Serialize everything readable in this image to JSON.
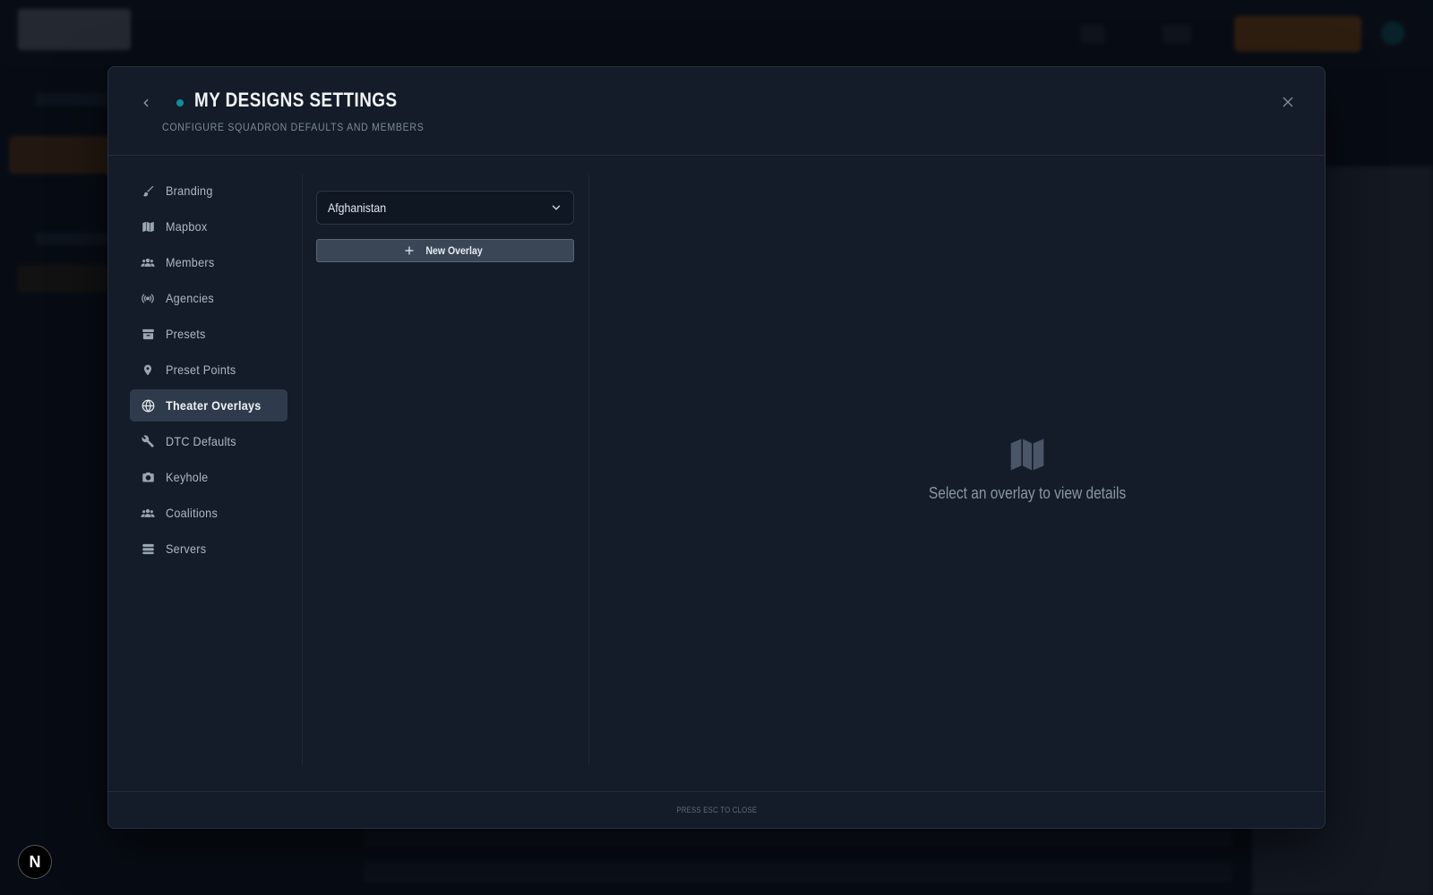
{
  "modal": {
    "title": "MY DESIGNS SETTINGS",
    "subtitle": "CONFIGURE SQUADRON DEFAULTS AND MEMBERS",
    "footer_hint": "PRESS ESC TO CLOSE"
  },
  "nav": {
    "items": [
      {
        "label": "Branding",
        "icon": "brush-icon"
      },
      {
        "label": "Mapbox",
        "icon": "map-icon"
      },
      {
        "label": "Members",
        "icon": "users-icon"
      },
      {
        "label": "Agencies",
        "icon": "broadcast-icon"
      },
      {
        "label": "Presets",
        "icon": "archive-icon"
      },
      {
        "label": "Preset Points",
        "icon": "location-pin-icon"
      },
      {
        "label": "Theater Overlays",
        "icon": "globe-icon"
      },
      {
        "label": "DTC Defaults",
        "icon": "tools-icon"
      },
      {
        "label": "Keyhole",
        "icon": "camera-icon"
      },
      {
        "label": "Coalitions",
        "icon": "users-icon"
      },
      {
        "label": "Servers",
        "icon": "database-icon"
      }
    ],
    "active": "Theater Overlays"
  },
  "overlays": {
    "theater_select": "Afghanistan",
    "new_button_label": "New Overlay"
  },
  "detail": {
    "empty_message": "Select an overlay to view details"
  },
  "badge": {
    "label": "N"
  },
  "colors": {
    "accent": "#0f8f9a",
    "orange": "#a8590b",
    "active_nav_bg": "#2f3b4c"
  }
}
